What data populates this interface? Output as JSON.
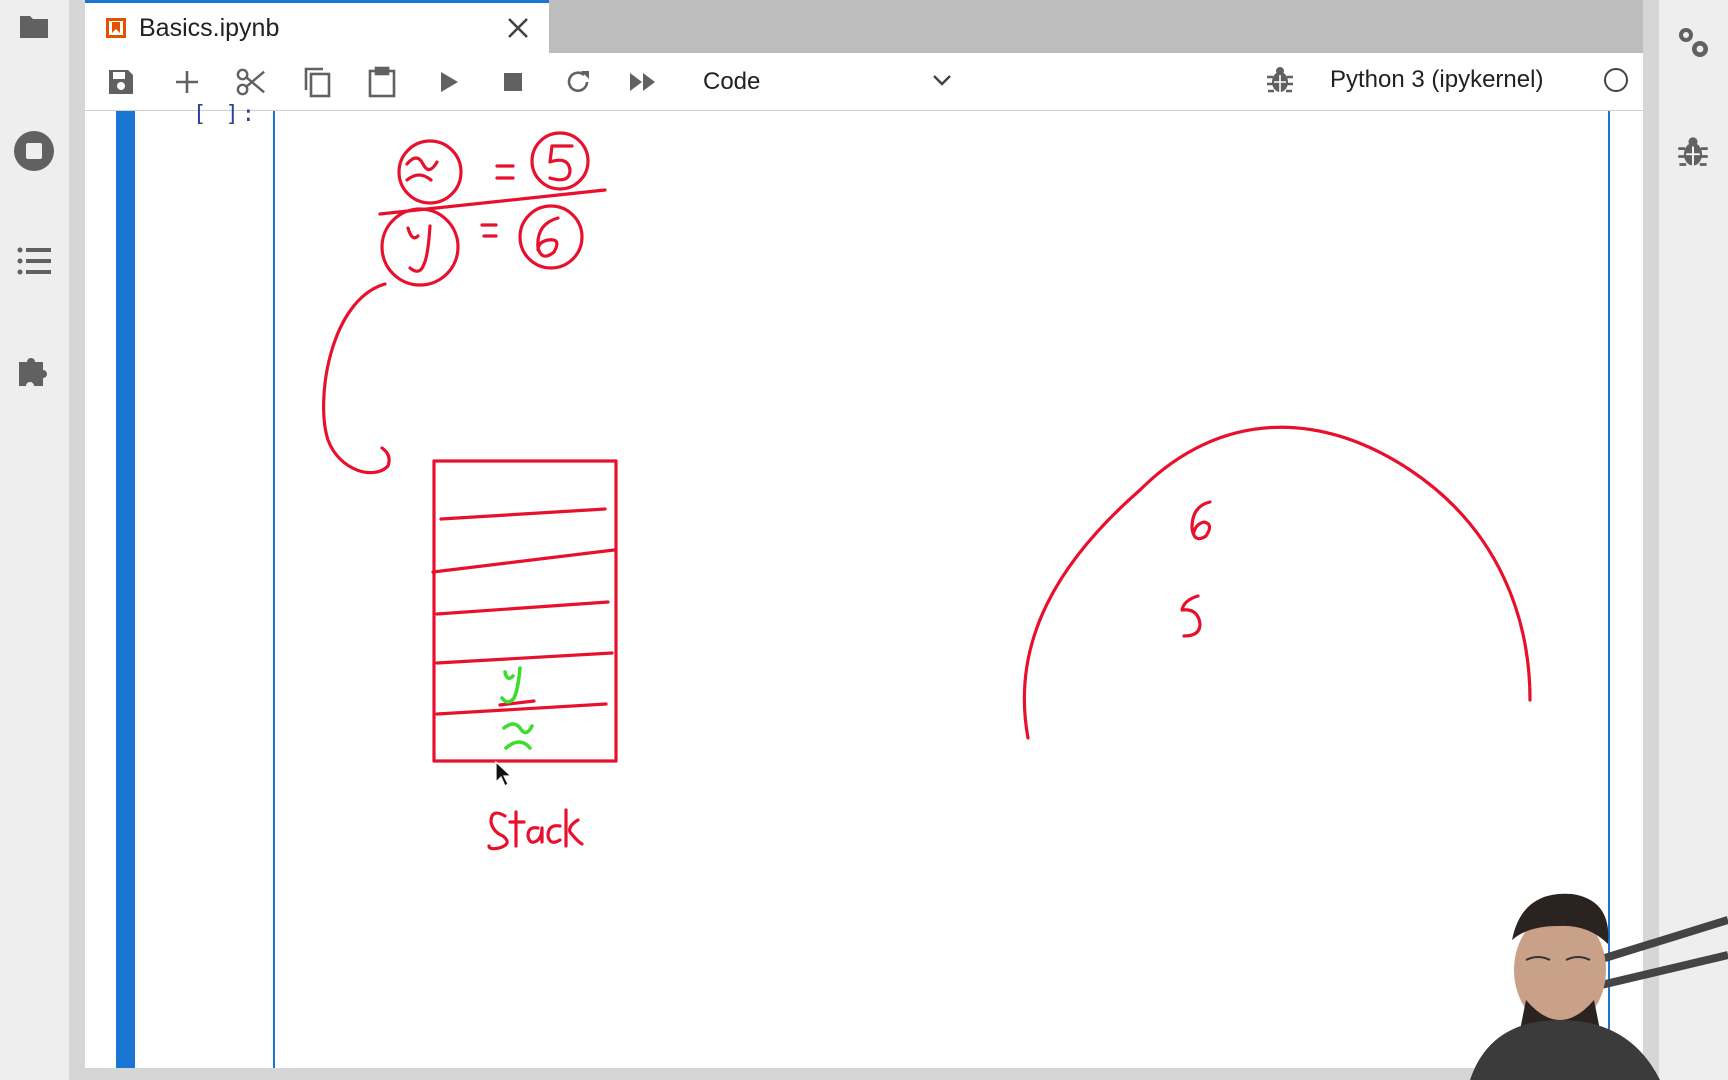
{
  "tab": {
    "title": "Basics.ipynb",
    "icon": "notebook-icon",
    "accent": "#e65100"
  },
  "toolbar": {
    "buttons": [
      {
        "name": "save-button",
        "icon": "save-icon"
      },
      {
        "name": "insert-cell-button",
        "icon": "plus-icon"
      },
      {
        "name": "cut-button",
        "icon": "scissors-icon"
      },
      {
        "name": "copy-button",
        "icon": "copy-icon"
      },
      {
        "name": "paste-button",
        "icon": "clipboard-icon"
      },
      {
        "name": "run-button",
        "icon": "play-icon"
      },
      {
        "name": "interrupt-button",
        "icon": "stop-icon"
      },
      {
        "name": "restart-button",
        "icon": "refresh-icon"
      },
      {
        "name": "run-all-button",
        "icon": "fast-forward-icon"
      }
    ],
    "cell_type": "Code",
    "kernel": "Python 3 (ipykernel)"
  },
  "cell": {
    "prompt": "[ ]:"
  },
  "drawing": {
    "ink_red": "#e8112d",
    "ink_green": "#3ddc2f",
    "equations": [
      {
        "var": "x",
        "value": "5",
        "struck": true
      },
      {
        "var": "y",
        "value": "6",
        "struck": false
      }
    ],
    "stack_label": "Stack",
    "stack_slots": [
      "y",
      "x"
    ],
    "heap_values": [
      "6",
      "5"
    ]
  },
  "colors": {
    "accent": "#1976d2",
    "toolbar_bg": "#ffffff",
    "panel_bg": "#eeeeee"
  }
}
